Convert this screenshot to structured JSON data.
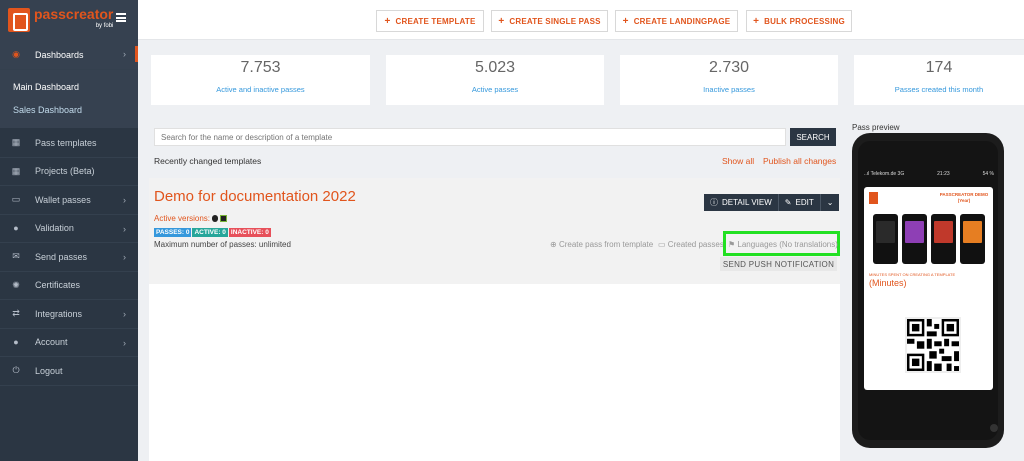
{
  "brand": {
    "name": "passcreator",
    "by": "by fobi"
  },
  "sidebar": {
    "dashboards": "Dashboards",
    "sub": [
      "Main Dashboard",
      "Sales Dashboard"
    ],
    "items": [
      {
        "label": "Pass templates",
        "icon": "grid-icon",
        "chevron": false
      },
      {
        "label": "Projects (Beta)",
        "icon": "grid-icon",
        "chevron": false
      },
      {
        "label": "Wallet passes",
        "icon": "card-icon",
        "chevron": true
      },
      {
        "label": "Validation",
        "icon": "globe-icon",
        "chevron": true
      },
      {
        "label": "Send passes",
        "icon": "envelope-icon",
        "chevron": true
      },
      {
        "label": "Certificates",
        "icon": "gear-icon",
        "chevron": false
      },
      {
        "label": "Integrations",
        "icon": "exchange-icon",
        "chevron": true
      },
      {
        "label": "Account",
        "icon": "user-icon",
        "chevron": true
      },
      {
        "label": "Logout",
        "icon": "power-icon",
        "chevron": false
      }
    ]
  },
  "toolbar": {
    "create_template": "CREATE TEMPLATE",
    "create_single_pass": "CREATE SINGLE PASS",
    "create_landingpage": "CREATE LANDINGPAGE",
    "bulk_processing": "BULK PROCESSING"
  },
  "stats": [
    {
      "value": "7.753",
      "label": "Active and inactive passes"
    },
    {
      "value": "5.023",
      "label": "Active passes"
    },
    {
      "value": "2.730",
      "label": "Inactive passes"
    },
    {
      "value": "174",
      "label": "Passes created this month"
    }
  ],
  "templates": {
    "search_placeholder": "Search for the name or description of a template",
    "search_button": "SEARCH",
    "recent_title": "Recently changed templates",
    "show_all": "Show all",
    "publish_all": "Publish all changes",
    "item": {
      "title": "Demo for documentation 2022",
      "active_versions": "Active versions:",
      "badges": {
        "passes": "PASSES: 0",
        "active": "ACTIVE: 0",
        "inactive": "INACTIVE: 0"
      },
      "max_passes": "Maximum number of passes: unlimited",
      "detail_view": "DETAIL VIEW",
      "edit": "EDIT",
      "create_pass": "Create pass from template",
      "created_passes": "Created passes",
      "languages": "Languages (No translations)",
      "send_push": "SEND PUSH NOTIFICATION"
    }
  },
  "preview": {
    "label": "Pass preview",
    "status_left": "..ıl Telekom.de  3G",
    "status_time": "21:23",
    "status_right": "54 %",
    "pass_header": "PASSCREATOR DEMO",
    "pass_header_sub": "(Year)",
    "minutes_label": "MINUTES SPENT ON CREATING A TEMPLATE",
    "minutes_value": "(Minutes)"
  },
  "colors": {
    "accent": "#e1551d",
    "sidebar": "#2b3643",
    "link": "#3598dc",
    "highlight": "#22e022"
  }
}
